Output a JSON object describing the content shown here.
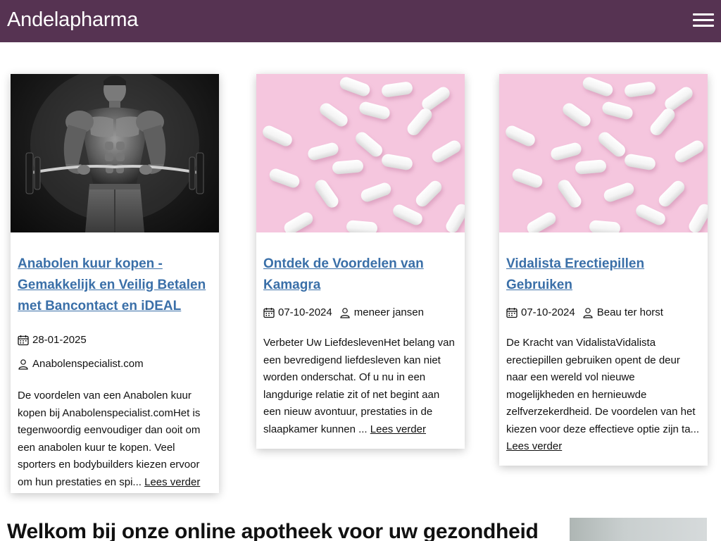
{
  "header": {
    "brand": "Andelapharma",
    "menu_icon": "hamburger-menu-icon",
    "background": "#563352"
  },
  "posts": [
    {
      "title": "Anabolen kuur kopen - Gemakkelijk en Veilig Betalen met Bancontact en iDEAL",
      "image": "bodybuilder-with-barbell-photo",
      "date": "28-01-2025",
      "author": "Anabolenspecialist.com",
      "excerpt": "De voordelen van een Anabolen kuur kopen bij Anabolenspecialist.comHet is tegenwoordig eenvoudiger dan ooit om een anabolen kuur te kopen. Veel sporters en bodybuilders kiezen ervoor om hun prestaties en spi...",
      "read_more": "Lees verder"
    },
    {
      "title": "Ontdek de Voordelen van Kamagra",
      "image": "white-capsules-on-pink-photo",
      "date": "07-10-2024",
      "author": "meneer jansen",
      "excerpt": "Verbeter Uw LiefdeslevenHet belang van een bevredigend liefdesleven kan niet worden onderschat. Of u nu in een langdurige relatie zit of net begint aan een nieuw avontuur, prestaties in de slaapkamer kunnen ...",
      "read_more": "Lees verder"
    },
    {
      "title": "Vidalista Erectiepillen Gebruiken",
      "image": "white-capsules-on-pink-photo",
      "date": "07-10-2024",
      "author": "Beau ter horst",
      "excerpt": "De Kracht van VidalistaVidalista erectiepillen gebruiken opent de deur naar een wereld vol nieuwe mogelijkheden en hernieuwde zelfverzekerdheid. De voordelen van het kiezen voor deze effectieve optie zijn ta...",
      "read_more": "Lees verder"
    }
  ],
  "icons": {
    "date": "calendar-icon",
    "author": "user-icon"
  },
  "colors": {
    "link": "#3a6fa8",
    "pink_background": "#f5c6de"
  },
  "main": {
    "heading": "Welkom bij onze online apotheek voor uw gezondheid"
  }
}
